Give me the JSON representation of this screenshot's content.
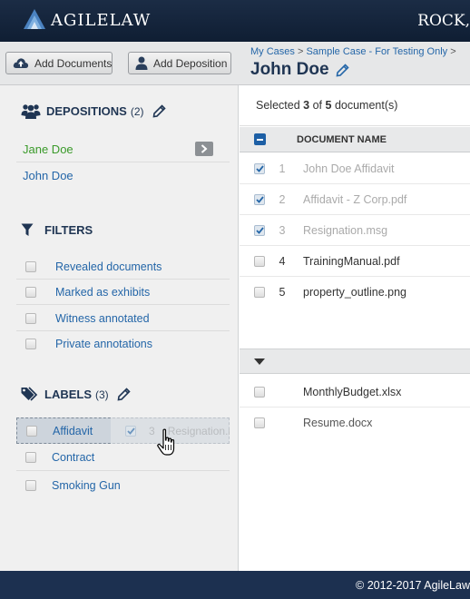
{
  "header": {
    "app_name": "AGILELAW",
    "user_name": "ROCK,"
  },
  "toolbar": {
    "add_documents_label": "Add Documents",
    "add_deposition_label": "Add Deposition",
    "breadcrumb": [
      "My Cases",
      "Sample Case - For Testing Only"
    ],
    "breadcrumb_sep": ">",
    "case_title": "John Doe"
  },
  "sidebar": {
    "depositions": {
      "title": "DEPOSITIONS",
      "count": "(2)",
      "items": [
        {
          "label": "Jane Doe",
          "active": true
        },
        {
          "label": "John Doe",
          "active": false
        }
      ]
    },
    "filters": {
      "title": "FILTERS",
      "items": [
        {
          "label": "Revealed documents"
        },
        {
          "label": "Marked as exhibits"
        },
        {
          "label": "Witness annotated"
        },
        {
          "label": "Private annotations"
        }
      ]
    },
    "labels": {
      "title": "LABELS",
      "count": "(3)",
      "items": [
        {
          "label": "Affidavit"
        },
        {
          "label": "Contract"
        },
        {
          "label": "Smoking Gun"
        }
      ]
    }
  },
  "drag": {
    "num": "3",
    "name": "Resignation.msg"
  },
  "main": {
    "selection": {
      "prefix": "Selected",
      "selected": "3",
      "of": "of",
      "total": "5",
      "suffix": "document(s)"
    },
    "column_header": "DOCUMENT NAME",
    "documents": [
      {
        "num": "1",
        "name": "John Doe Affidavit",
        "checked": true
      },
      {
        "num": "2",
        "name": "Affidavit - Z Corp.pdf",
        "checked": true
      },
      {
        "num": "3",
        "name": "Resignation.msg",
        "checked": true
      },
      {
        "num": "4",
        "name": "TrainingManual.pdf",
        "checked": false
      },
      {
        "num": "5",
        "name": "property_outline.png",
        "checked": false
      }
    ],
    "group_documents": [
      {
        "name": "MonthlyBudget.xlsx"
      },
      {
        "name": "Resume.docx"
      }
    ]
  },
  "footer": {
    "copyright": "© 2012-2017 AgileLaw"
  },
  "colors": {
    "header_bg": "#1b2c45",
    "link": "#2466a8",
    "active_green": "#3a9a2a",
    "heading_navy": "#1f3553",
    "footer_bg": "#1c3050"
  }
}
